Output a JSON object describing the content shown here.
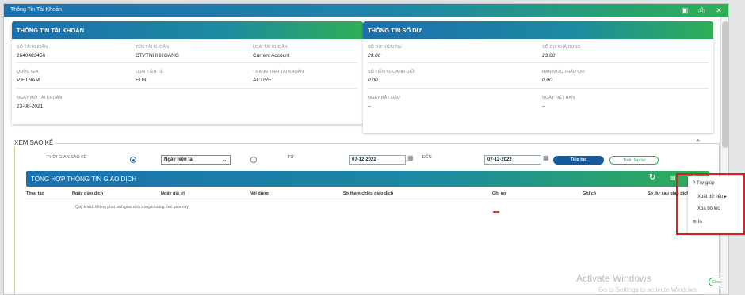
{
  "window": {
    "title": "Thông Tin Tài Khoản"
  },
  "account_card": {
    "heading": "THÔNG TIN TÀI KHOẢN",
    "fields": [
      {
        "label": "SỐ TÀI KHOẢN",
        "value": "2640483456"
      },
      {
        "label": "TÊN TÀI KHOẢN",
        "value": "CTYTNHHHOANG"
      },
      {
        "label": "LOẠI TÀI KHOẢN",
        "value": "Current Account"
      },
      {
        "label": "QUỐC GIA",
        "value": "VIETNAM"
      },
      {
        "label": "LOẠI TIỀN TỆ",
        "value": "EUR"
      },
      {
        "label": "TRẠNG THÁI TÀI KHOẢN",
        "value": "ACTIVE"
      },
      {
        "label": "NGÀY MỞ TÀI KHOẢN",
        "value": "23-08-2021"
      }
    ]
  },
  "balance_card": {
    "heading": "THÔNG TIN SỐ DƯ",
    "fields": [
      {
        "label": "SỐ DƯ HIỆN TẠI",
        "value": "23.00"
      },
      {
        "label": "SỐ DƯ KHẢ DỤNG",
        "value": "23.00"
      },
      {
        "label": "SỐ TIỀN KHOANH GIỮ",
        "value": "0.00"
      },
      {
        "label": "HẠN MỨC THẤU CHI",
        "value": "0.00"
      },
      {
        "label": "NGÀY BẮT ĐẦU",
        "value": "--"
      },
      {
        "label": "NGÀY HẾT HẠN",
        "value": "--"
      }
    ]
  },
  "statement": {
    "title": "XEM SAO KÊ",
    "period_label": "THỜI GIAN SAO KÊ",
    "period_select": "Ngày hiện tại",
    "from_label": "TỪ",
    "from_date": "07-12-2022",
    "to_label": "ĐẾN",
    "to_date": "07-12-2022",
    "continue_button": "Tiếp tục",
    "reset_button": "Thiết lập lại"
  },
  "transactions": {
    "heading": "TỔNG HỢP THÔNG TIN GIAO DỊCH",
    "columns": [
      "Thao tác",
      "Ngày giao dịch",
      "Ngày giá trị",
      "Nội dung",
      "Số tham chiếu giao dịch",
      "Ghi nợ",
      "Ghi có",
      "Số dư sau giao dịch"
    ],
    "empty_message": "Quý khách không phát sinh giao dịch trong khoảng thời gian này"
  },
  "context_menu": {
    "items": [
      "Trợ giúp",
      "Xuất dữ liệu",
      "Xóa bộ lọc",
      "In"
    ]
  },
  "watermark": {
    "line1": "Activate Windows",
    "line2": "Go to Settings to activate Windows."
  },
  "close_button": "Close",
  "colors": {
    "header_start": "#1b6fae",
    "header_end": "#2fae55",
    "highlight": "#e02020"
  }
}
